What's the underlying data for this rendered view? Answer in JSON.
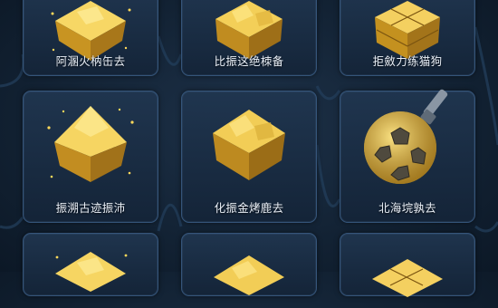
{
  "colors": {
    "accent_gold": "#f2c744",
    "card_border": "#35557a",
    "background": "#132335"
  },
  "cards": [
    {
      "label": "阿溷火枘缶去",
      "icon": "gold-ore-cube-icon"
    },
    {
      "label": "比振这绝栜备",
      "icon": "gold-ore-cube-icon"
    },
    {
      "label": "拒斂力练猫狗",
      "icon": "gold-block-cube-icon"
    },
    {
      "label": "振溯古迹振沛",
      "icon": "gold-ore-cube-icon"
    },
    {
      "label": "化振金烤鹿去",
      "icon": "gold-ore-cube-icon"
    },
    {
      "label": "北海垸孰去",
      "icon": "gold-sphere-drill-icon"
    },
    {
      "label": "",
      "icon": "gold-ore-cube-icon"
    },
    {
      "label": "",
      "icon": "gold-ore-cube-icon"
    },
    {
      "label": "",
      "icon": "gold-ore-cube-icon"
    }
  ]
}
